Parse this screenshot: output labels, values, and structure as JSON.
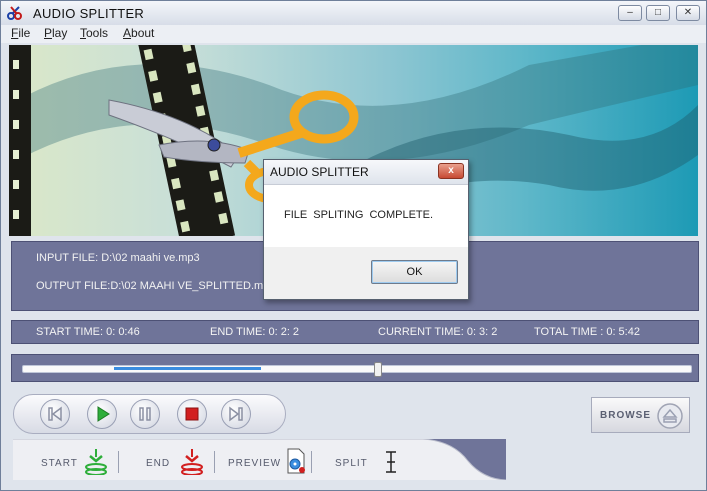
{
  "window": {
    "title": "AUDIO SPLITTER",
    "minimize_glyph": "–",
    "maximize_glyph": "□",
    "close_glyph": "✕"
  },
  "menu": [
    {
      "label": "File",
      "mnemonic": "F",
      "rest": "ile"
    },
    {
      "label": "Play",
      "mnemonic": "P",
      "rest": "lay"
    },
    {
      "label": "Tools",
      "mnemonic": "T",
      "rest": "ools"
    },
    {
      "label": "About",
      "mnemonic": "A",
      "rest": "bout"
    }
  ],
  "files": {
    "input": "INPUT FILE: D:\\02 maahi ve.mp3",
    "output": "OUTPUT FILE:D:\\02 MAAHI VE_SPLITTED.mp3"
  },
  "times": {
    "start": "START TIME:  0: 0:46",
    "end": "END TIME: 0: 2: 2",
    "current": "CURRENT TIME: 0: 3: 2",
    "total": "TOTAL TIME : 0: 5:42"
  },
  "controls": {
    "browse": "BROWSE",
    "start": "START",
    "end": "END",
    "preview": "PREVIEW",
    "split": "SPLIT"
  },
  "dialog": {
    "title": "AUDIO SPLITTER",
    "close_glyph": "x",
    "message": "FILE SPLITING COMPLETE.",
    "ok": "OK"
  },
  "icons": {
    "app": "scissors-app-icon",
    "rewind": "rewind-icon",
    "play": "play-icon",
    "pause": "pause-icon",
    "stop": "stop-icon",
    "forward": "fast-forward-icon",
    "eject": "eject-icon",
    "start_marker": "start-marker-icon",
    "end_marker": "end-marker-icon",
    "preview": "preview-icon",
    "split": "split-cursor-icon"
  },
  "colors": {
    "panel": "#6f7499",
    "play": "#2eae3a",
    "stop": "#d21f1f",
    "selection": "#3a8de0",
    "banner_accent": "#f4a81c"
  }
}
